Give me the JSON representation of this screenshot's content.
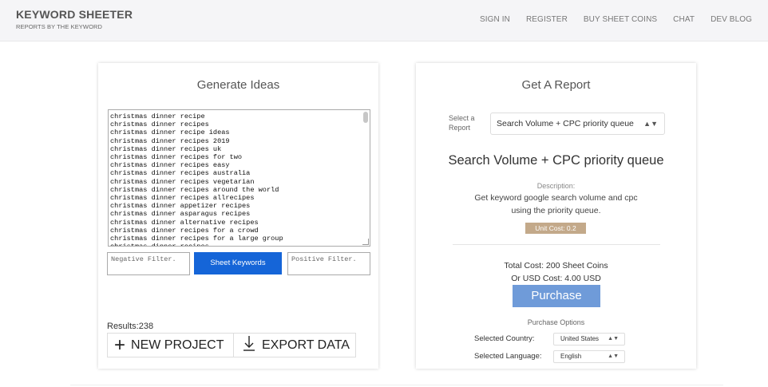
{
  "header": {
    "brand_title": "KEYWORD SHEETER",
    "brand_subtitle": "REPORTS BY THE KEYWORD",
    "nav": [
      "SIGN IN",
      "REGISTER",
      "BUY SHEET COINS",
      "CHAT",
      "DEV BLOG"
    ]
  },
  "ideas": {
    "title": "Generate Ideas",
    "keywords": [
      "christmas dinner recipe",
      "christmas dinner recipes",
      "christmas dinner recipe ideas",
      "christmas dinner recipes 2019",
      "christmas dinner recipes uk",
      "christmas dinner recipes for two",
      "christmas dinner recipes easy",
      "christmas dinner recipes australia",
      "christmas dinner recipes vegetarian",
      "christmas dinner recipes around the world",
      "christmas dinner recipes allrecipes",
      "christmas dinner appetizer recipes",
      "christmas dinner asparagus recipes",
      "christmas dinner alternative recipes",
      "christmas dinner recipes for a crowd",
      "christmas dinner recipes for a large group",
      "christmas dinner recipes"
    ],
    "negative_placeholder": "Negative Filter.",
    "positive_placeholder": "Positive Filter.",
    "sheet_button": "Sheet Keywords",
    "results": "Results:238",
    "new_project": "NEW PROJECT",
    "export_data": "EXPORT DATA"
  },
  "report": {
    "title": "Get A Report",
    "select_label": "Select a Report",
    "selected_report": "Search Volume + CPC priority queue",
    "heading": "Search Volume + CPC priority queue",
    "description_label": "Description:",
    "description": "Get keyword google search volume and cpc using the priority queue.",
    "unit_cost": "Unit Cost: 0.2",
    "total_cost": "Total Cost: 200 Sheet Coins",
    "usd_cost": "Or USD Cost: 4.00 USD",
    "purchase_button": "Purchase",
    "purchase_options": "Purchase Options",
    "country_label": "Selected Country:",
    "country_value": "United States",
    "language_label": "Selected Language:",
    "language_value": "English"
  },
  "icons": {
    "plus": "plus-icon",
    "download": "download-icon",
    "select_arrows": "updown-arrow-icon"
  }
}
